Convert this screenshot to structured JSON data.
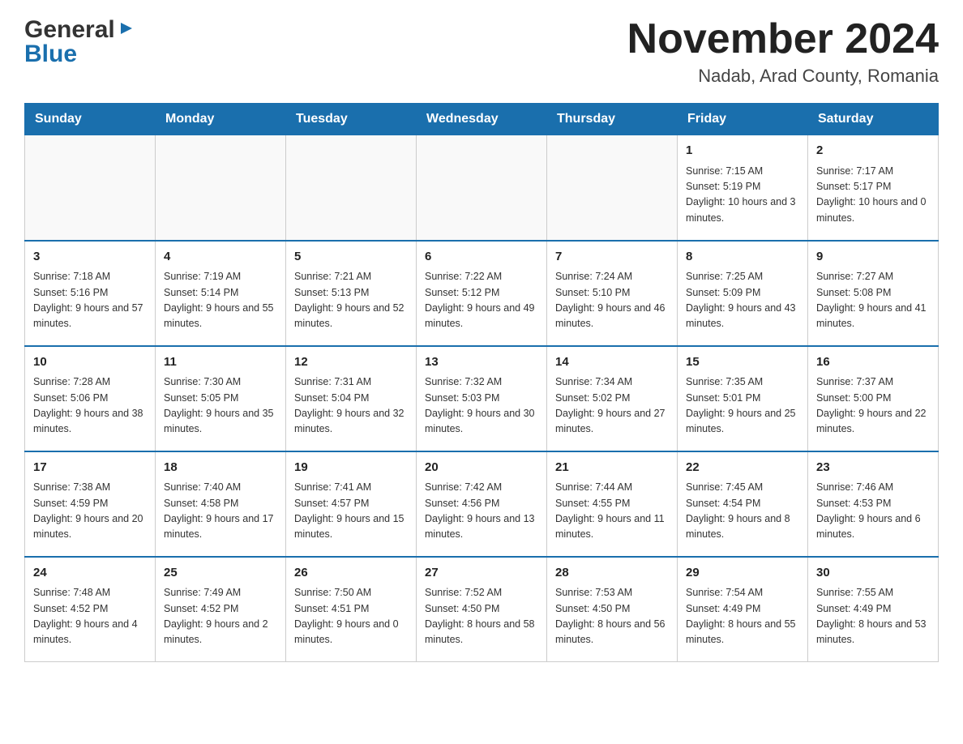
{
  "logo": {
    "general": "General",
    "blue": "Blue"
  },
  "header": {
    "month_title": "November 2024",
    "location": "Nadab, Arad County, Romania"
  },
  "days_of_week": [
    "Sunday",
    "Monday",
    "Tuesday",
    "Wednesday",
    "Thursday",
    "Friday",
    "Saturday"
  ],
  "weeks": [
    {
      "days": [
        {
          "number": "",
          "info": ""
        },
        {
          "number": "",
          "info": ""
        },
        {
          "number": "",
          "info": ""
        },
        {
          "number": "",
          "info": ""
        },
        {
          "number": "",
          "info": ""
        },
        {
          "number": "1",
          "info": "Sunrise: 7:15 AM\nSunset: 5:19 PM\nDaylight: 10 hours and 3 minutes."
        },
        {
          "number": "2",
          "info": "Sunrise: 7:17 AM\nSunset: 5:17 PM\nDaylight: 10 hours and 0 minutes."
        }
      ]
    },
    {
      "days": [
        {
          "number": "3",
          "info": "Sunrise: 7:18 AM\nSunset: 5:16 PM\nDaylight: 9 hours and 57 minutes."
        },
        {
          "number": "4",
          "info": "Sunrise: 7:19 AM\nSunset: 5:14 PM\nDaylight: 9 hours and 55 minutes."
        },
        {
          "number": "5",
          "info": "Sunrise: 7:21 AM\nSunset: 5:13 PM\nDaylight: 9 hours and 52 minutes."
        },
        {
          "number": "6",
          "info": "Sunrise: 7:22 AM\nSunset: 5:12 PM\nDaylight: 9 hours and 49 minutes."
        },
        {
          "number": "7",
          "info": "Sunrise: 7:24 AM\nSunset: 5:10 PM\nDaylight: 9 hours and 46 minutes."
        },
        {
          "number": "8",
          "info": "Sunrise: 7:25 AM\nSunset: 5:09 PM\nDaylight: 9 hours and 43 minutes."
        },
        {
          "number": "9",
          "info": "Sunrise: 7:27 AM\nSunset: 5:08 PM\nDaylight: 9 hours and 41 minutes."
        }
      ]
    },
    {
      "days": [
        {
          "number": "10",
          "info": "Sunrise: 7:28 AM\nSunset: 5:06 PM\nDaylight: 9 hours and 38 minutes."
        },
        {
          "number": "11",
          "info": "Sunrise: 7:30 AM\nSunset: 5:05 PM\nDaylight: 9 hours and 35 minutes."
        },
        {
          "number": "12",
          "info": "Sunrise: 7:31 AM\nSunset: 5:04 PM\nDaylight: 9 hours and 32 minutes."
        },
        {
          "number": "13",
          "info": "Sunrise: 7:32 AM\nSunset: 5:03 PM\nDaylight: 9 hours and 30 minutes."
        },
        {
          "number": "14",
          "info": "Sunrise: 7:34 AM\nSunset: 5:02 PM\nDaylight: 9 hours and 27 minutes."
        },
        {
          "number": "15",
          "info": "Sunrise: 7:35 AM\nSunset: 5:01 PM\nDaylight: 9 hours and 25 minutes."
        },
        {
          "number": "16",
          "info": "Sunrise: 7:37 AM\nSunset: 5:00 PM\nDaylight: 9 hours and 22 minutes."
        }
      ]
    },
    {
      "days": [
        {
          "number": "17",
          "info": "Sunrise: 7:38 AM\nSunset: 4:59 PM\nDaylight: 9 hours and 20 minutes."
        },
        {
          "number": "18",
          "info": "Sunrise: 7:40 AM\nSunset: 4:58 PM\nDaylight: 9 hours and 17 minutes."
        },
        {
          "number": "19",
          "info": "Sunrise: 7:41 AM\nSunset: 4:57 PM\nDaylight: 9 hours and 15 minutes."
        },
        {
          "number": "20",
          "info": "Sunrise: 7:42 AM\nSunset: 4:56 PM\nDaylight: 9 hours and 13 minutes."
        },
        {
          "number": "21",
          "info": "Sunrise: 7:44 AM\nSunset: 4:55 PM\nDaylight: 9 hours and 11 minutes."
        },
        {
          "number": "22",
          "info": "Sunrise: 7:45 AM\nSunset: 4:54 PM\nDaylight: 9 hours and 8 minutes."
        },
        {
          "number": "23",
          "info": "Sunrise: 7:46 AM\nSunset: 4:53 PM\nDaylight: 9 hours and 6 minutes."
        }
      ]
    },
    {
      "days": [
        {
          "number": "24",
          "info": "Sunrise: 7:48 AM\nSunset: 4:52 PM\nDaylight: 9 hours and 4 minutes."
        },
        {
          "number": "25",
          "info": "Sunrise: 7:49 AM\nSunset: 4:52 PM\nDaylight: 9 hours and 2 minutes."
        },
        {
          "number": "26",
          "info": "Sunrise: 7:50 AM\nSunset: 4:51 PM\nDaylight: 9 hours and 0 minutes."
        },
        {
          "number": "27",
          "info": "Sunrise: 7:52 AM\nSunset: 4:50 PM\nDaylight: 8 hours and 58 minutes."
        },
        {
          "number": "28",
          "info": "Sunrise: 7:53 AM\nSunset: 4:50 PM\nDaylight: 8 hours and 56 minutes."
        },
        {
          "number": "29",
          "info": "Sunrise: 7:54 AM\nSunset: 4:49 PM\nDaylight: 8 hours and 55 minutes."
        },
        {
          "number": "30",
          "info": "Sunrise: 7:55 AM\nSunset: 4:49 PM\nDaylight: 8 hours and 53 minutes."
        }
      ]
    }
  ]
}
